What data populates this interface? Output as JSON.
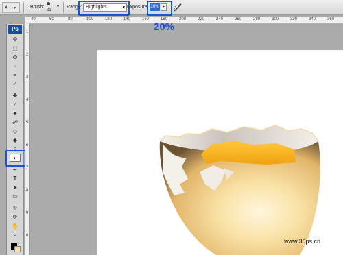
{
  "options_bar": {
    "brush_label": "Brush:",
    "brush_size": "31",
    "range_label": "Range:",
    "range_value": "Highlights",
    "exposure_label": "Exposure:",
    "exposure_value": "20%",
    "annotation": "20%"
  },
  "tools_panel": {
    "logo": "Ps",
    "tools": [
      "move-tool",
      "marquee-tool",
      "lasso-tool",
      "quick-selection-tool",
      "crop-tool",
      "eyedropper-tool",
      "healing-brush-tool",
      "brush-tool",
      "clone-stamp-tool",
      "history-brush-tool",
      "eraser-tool",
      "paint-bucket-tool",
      "blur-tool",
      "dodge-tool",
      "pen-tool",
      "type-tool",
      "path-selection-tool",
      "shape-tool",
      "3d-rotate-tool",
      "3d-orbit-tool",
      "hand-tool",
      "zoom-tool"
    ],
    "active_tool": "dodge-tool",
    "foreground_color": "#000000",
    "background_color": "#f5deb0"
  },
  "rulers": {
    "top_labels": [
      "40",
      "60",
      "80",
      "100",
      "120",
      "140",
      "160",
      "180",
      "200",
      "220",
      "240",
      "260",
      "280",
      "300",
      "320",
      "340",
      "360"
    ],
    "left_labels": [
      "1",
      "2",
      "3",
      "4",
      "5",
      "6",
      "7",
      "8",
      "9",
      "0"
    ]
  },
  "canvas": {
    "watermark": "www.36ps.cn"
  },
  "colors": {
    "highlight_blue": "#1a52d8",
    "canvas_bg": "#ffffff",
    "workspace_bg": "#ababab"
  }
}
